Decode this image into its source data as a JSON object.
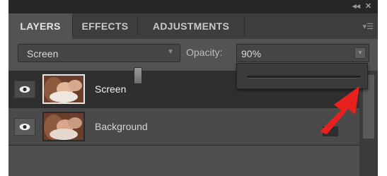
{
  "window": {
    "collapse_label": "◂◂",
    "close_label": "✕"
  },
  "tabs": [
    {
      "label": "LAYERS",
      "active": true
    },
    {
      "label": "EFFECTS",
      "active": false
    },
    {
      "label": "ADJUSTMENTS",
      "active": false
    }
  ],
  "panel_menu_icon": "panel-menu-icon",
  "blend_mode": {
    "value": "Screen"
  },
  "opacity": {
    "label": "Opacity:",
    "value": "90%",
    "slider_fraction": 0.9
  },
  "layers": [
    {
      "name": "Screen",
      "selected": true,
      "visible": true
    },
    {
      "name": "Background",
      "selected": false,
      "visible": true
    }
  ],
  "colors": {
    "panel_bg": "#535353",
    "selected_row": "#2f2f2f",
    "annotation_arrow": "#e8211e"
  }
}
